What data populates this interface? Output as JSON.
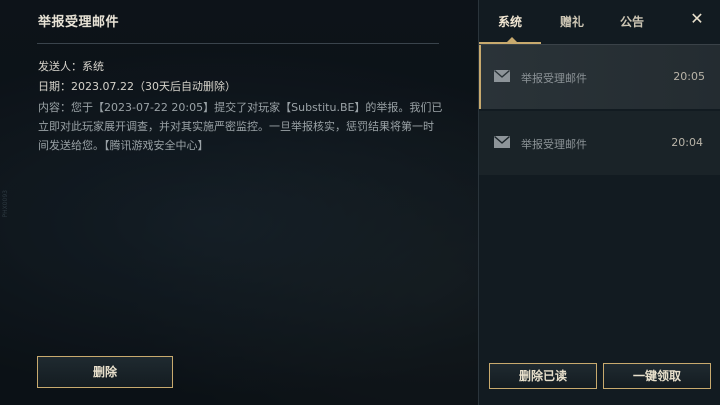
{
  "detail": {
    "title": "举报受理邮件",
    "sender": "发送人：系统",
    "date": "日期：2023.07.22（30天后自动删除）",
    "body": "内容：您于【2023-07-22 20:05】提交了对玩家【Substitu.BE】的举报。我们已立即对此玩家展开调查，并对其实施严密监控。一旦举报核实，惩罚结果将第一时间发送给您。【腾讯游戏安全中心】",
    "side_mark": "PHX0093",
    "delete_label": "删除"
  },
  "tabs": [
    {
      "label": "系统",
      "active": true
    },
    {
      "label": "赠礼",
      "active": false
    },
    {
      "label": "公告",
      "active": false
    }
  ],
  "close_glyph": "✕",
  "mails": [
    {
      "title": "举报受理邮件",
      "time": "20:05",
      "icon": "envelope-icon",
      "selected": true
    },
    {
      "title": "举报受理邮件",
      "time": "20:04",
      "icon": "envelope-icon",
      "selected": false
    }
  ],
  "footer": {
    "delete_read_label": "删除已读",
    "claim_all_label": "一键领取"
  },
  "colors": {
    "accent_gold": "#c8aa6e",
    "text_primary": "#e8e3d6",
    "text_secondary": "#9aa2a6"
  }
}
